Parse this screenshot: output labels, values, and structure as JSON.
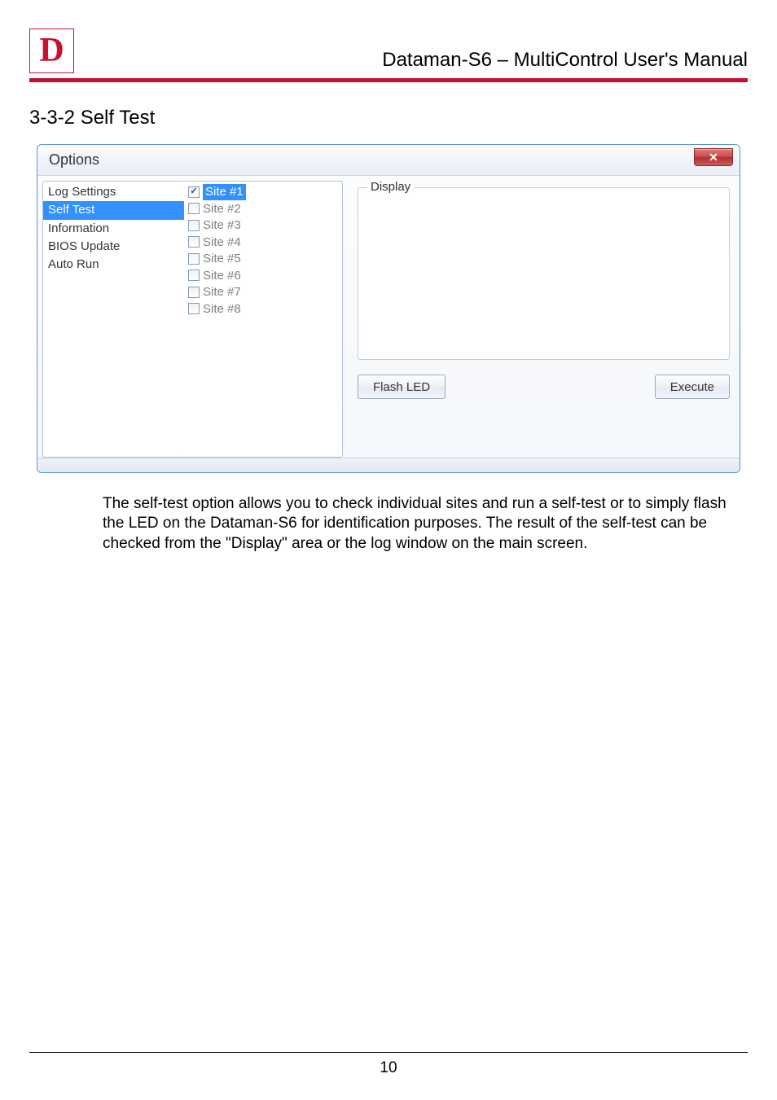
{
  "header": {
    "logo_letter": "D",
    "title": "Dataman-S6 – MultiControl User's Manual"
  },
  "section_heading": "3-3-2 Self Test",
  "dialog": {
    "title": "Options",
    "close_symbol": "✕",
    "nav_items": [
      "Log Settings",
      "Self Test",
      "Information",
      "BIOS Update",
      "Auto Run"
    ],
    "nav_selected_index": 1,
    "sites": [
      {
        "label": "Site #1",
        "checked": true,
        "enabled": true,
        "selected": true
      },
      {
        "label": "Site #2",
        "checked": false,
        "enabled": false,
        "selected": false
      },
      {
        "label": "Site #3",
        "checked": false,
        "enabled": false,
        "selected": false
      },
      {
        "label": "Site #4",
        "checked": false,
        "enabled": false,
        "selected": false
      },
      {
        "label": "Site #5",
        "checked": false,
        "enabled": false,
        "selected": false
      },
      {
        "label": "Site #6",
        "checked": false,
        "enabled": false,
        "selected": false
      },
      {
        "label": "Site #7",
        "checked": false,
        "enabled": false,
        "selected": false
      },
      {
        "label": "Site #8",
        "checked": false,
        "enabled": false,
        "selected": false
      }
    ],
    "group_label": "Display",
    "flash_led_btn": "Flash LED",
    "execute_btn": "Execute"
  },
  "paragraph": "The self-test option allows you to check individual sites and run a self-test or to simply flash the LED on the Dataman-S6 for identification purposes. The result of the self-test can be checked from the \"Display\" area or the log window on the main screen.",
  "page_number": "10"
}
